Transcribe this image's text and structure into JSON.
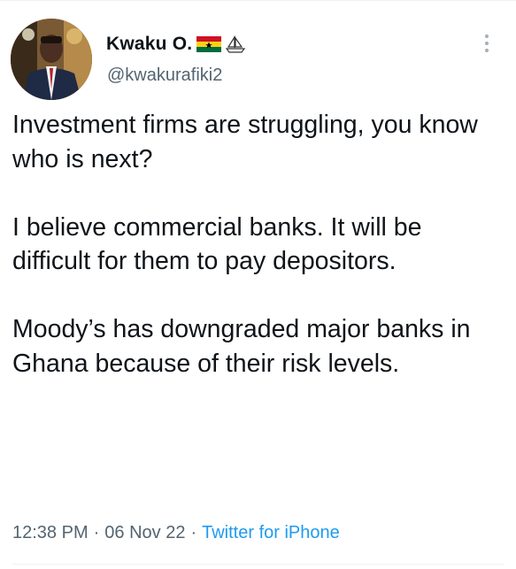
{
  "author": {
    "display_name": "Kwaku O.",
    "handle": "@kwakurafiki2",
    "badges": [
      "ghana-flag-icon",
      "ship-icon"
    ]
  },
  "tweet": {
    "paragraphs": [
      "Investment firms are struggling, you know who is next?",
      "I believe commercial banks. It will be difficult for them to pay depositors.",
      "Moody’s has downgraded major banks in Ghana because of their risk levels."
    ],
    "time": "12:38 PM",
    "date": "06 Nov 22",
    "separator": "·",
    "source": "Twitter for iPhone"
  },
  "colors": {
    "text": "#0f1419",
    "secondary": "#536471",
    "link": "#1d9bf0",
    "divider": "#eff3f4"
  },
  "icons": {
    "more": "more-vertical-icon"
  }
}
